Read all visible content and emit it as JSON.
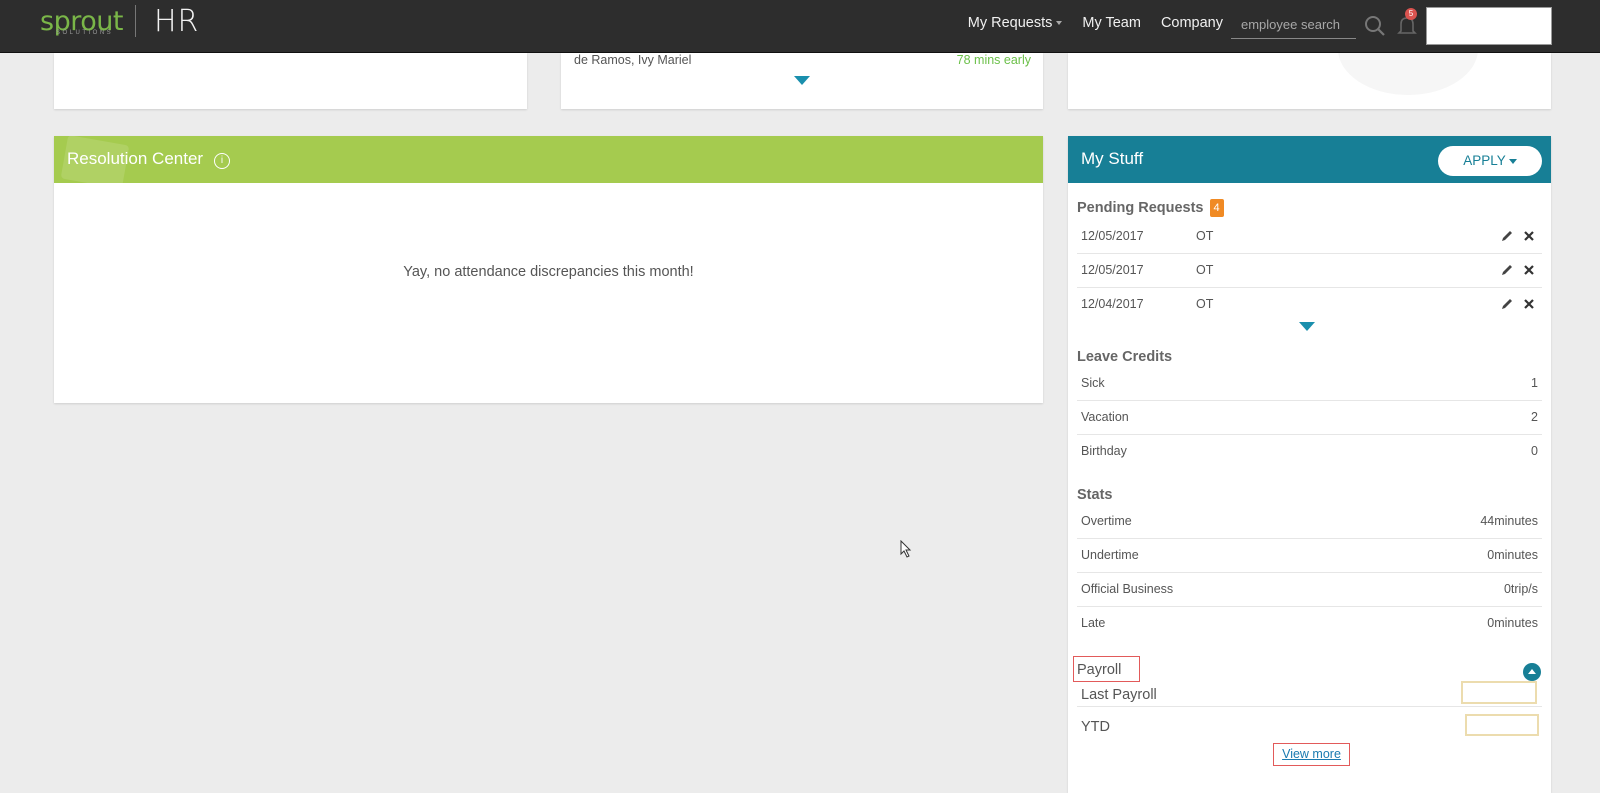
{
  "brand": {
    "logo_text": "sprout",
    "logo_sub": "SOLUTIONS",
    "product": "HR"
  },
  "nav": {
    "my_requests": "My Requests",
    "my_team": "My Team",
    "company": "Company",
    "search_placeholder": "employee search",
    "notification_count": "5"
  },
  "top_middle_card": {
    "name": "de Ramos, Ivy Mariel",
    "status": "78 mins early"
  },
  "resolution_center": {
    "title": "Resolution Center",
    "info": "i",
    "message": "Yay, no attendance discrepancies this month!"
  },
  "my_stuff": {
    "title": "My Stuff",
    "apply_label": "APPLY",
    "pending": {
      "title": "Pending Requests",
      "count": "4",
      "items": [
        {
          "date": "12/05/2017",
          "type": "OT"
        },
        {
          "date": "12/05/2017",
          "type": "OT"
        },
        {
          "date": "12/04/2017",
          "type": "OT"
        }
      ]
    },
    "leave_credits": {
      "title": "Leave Credits",
      "items": [
        {
          "label": "Sick",
          "value": "1"
        },
        {
          "label": "Vacation",
          "value": "2"
        },
        {
          "label": "Birthday",
          "value": "0"
        }
      ]
    },
    "stats": {
      "title": "Stats",
      "items": [
        {
          "label": "Overtime",
          "value": "44minutes"
        },
        {
          "label": "Undertime",
          "value": "0minutes"
        },
        {
          "label": "Official Business",
          "value": "0trip/s"
        },
        {
          "label": "Late",
          "value": "0minutes"
        }
      ]
    },
    "payroll": {
      "title": "Payroll",
      "last_payroll": "Last Payroll",
      "ytd": "YTD",
      "view_more": "View more"
    }
  },
  "colors": {
    "topbar": "#2d2d2d",
    "resolution_header": "#a5cb4f",
    "my_stuff_header": "#177f96",
    "badge": "#f08a24",
    "early": "#6cc04a"
  }
}
